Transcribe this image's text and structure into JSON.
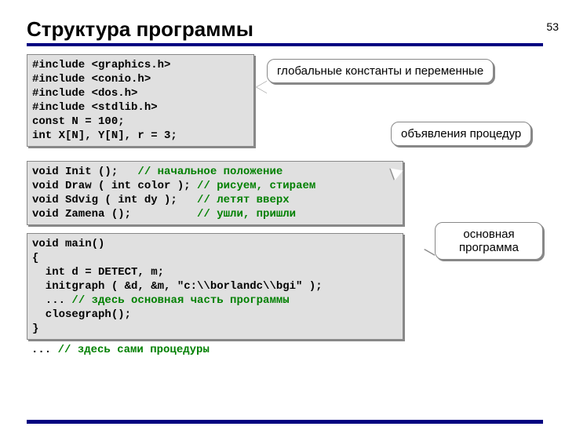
{
  "page_number": "53",
  "title": "Структура программы",
  "code_block1": "#include <graphics.h>\n#include <conio.h>\n#include <dos.h>\n#include <stdlib.h>\nconst N = 100;\nint X[N], Y[N], r = 3;",
  "code_block2_html": "void Init ();   <span class='cm'>// начальное положение</span>\nvoid Draw ( int color ); <span class='cm'>// рисуем, стираем</span>\nvoid Sdvig ( int dy );   <span class='cm'>// летят вверх</span>\nvoid Zamena ();          <span class='cm'>// ушли, пришли</span>",
  "code_block3_html": "void main()\n{\n  int d = DETECT, m;\n  initgraph ( &d, &m, \"c:\\\\borlandc\\\\bgi\" );\n  ... <span class='cm'>// здесь основная часть программы</span>\n  closegraph();\n}",
  "free_code_html": "... <span class='cm'>// здесь сами процедуры</span>",
  "callout1": "глобальные\nконстанты и\nпеременные",
  "callout2": "объявления\nпроцедур",
  "callout3": "основная\nпрограмма"
}
